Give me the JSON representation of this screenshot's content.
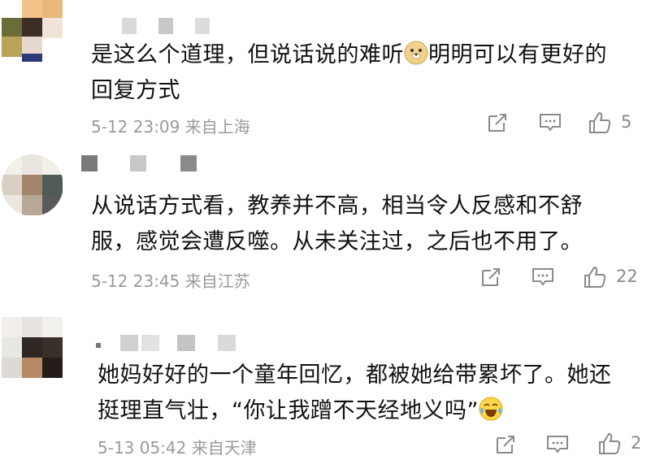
{
  "comments": [
    {
      "text_lines": [
        "是这么个道理，但说话说的难听",
        "明明可以有更好的",
        "回复方式"
      ],
      "emoji": "doge-emoji",
      "date": "5-12 23:09",
      "location": "来自上海",
      "likes": "5"
    },
    {
      "text_lines": [
        "从说话方式看，教养并不高，相当令人反感和不舒",
        "服，感觉会遭反噬。从未关注过，之后也不用了。"
      ],
      "date": "5-12 23:45",
      "location": "来自江苏",
      "likes": "22"
    },
    {
      "text_lines": [
        "她妈好好的一个童年回忆，都被她给带累坏了。她还",
        "挺理直气壮，“你让我蹭不天经地义吗”"
      ],
      "emoji": "laugh-cry-emoji",
      "date": "5-13 05:42",
      "location": "来自天津",
      "likes": "2"
    }
  ],
  "icons": {
    "share": "share-icon",
    "reply": "comment-icon",
    "like": "thumbs-up-icon"
  },
  "colors": {
    "text": "#111111",
    "meta": "#9a9a9a",
    "icon": "#8a8a8a"
  }
}
